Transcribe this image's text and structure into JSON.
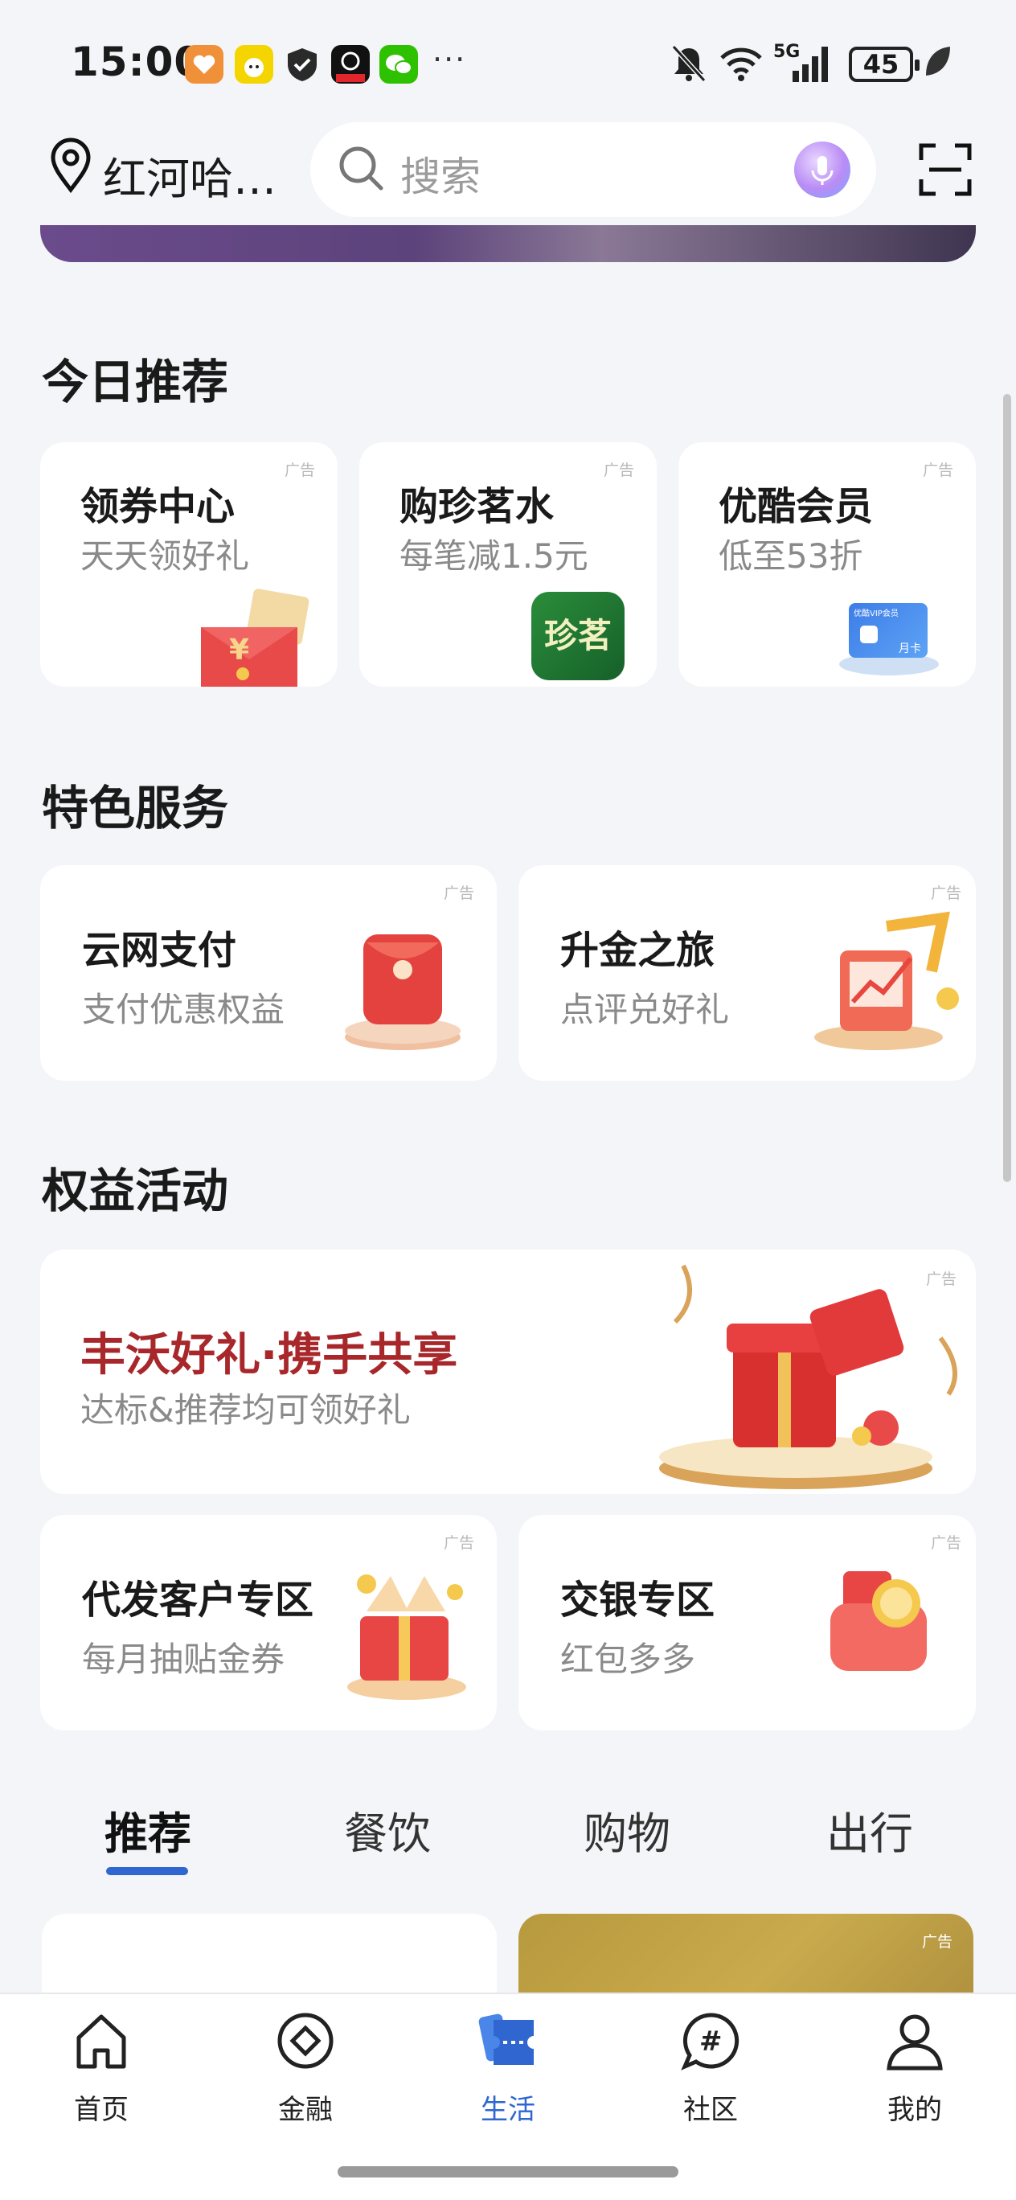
{
  "status_bar": {
    "time": "15:00",
    "network": "5G",
    "battery": "45"
  },
  "header": {
    "location": "红河哈…",
    "search_placeholder": "搜索"
  },
  "today_section": {
    "title": "今日推荐",
    "cards": [
      {
        "title": "领券中心",
        "subtitle": "天天领好礼",
        "ad": "广告"
      },
      {
        "title": "购珍茗水",
        "subtitle": "每笔减1.5元",
        "ad": "广告",
        "logo_text": "珍茗"
      },
      {
        "title": "优酷会员",
        "subtitle": "低至53折",
        "ad": "广告",
        "card_top": "优酷VIP会员",
        "card_bottom": "月卡"
      }
    ]
  },
  "featured_section": {
    "title": "特色服务",
    "cards": [
      {
        "title": "云网支付",
        "subtitle": "支付优惠权益",
        "ad": "广告"
      },
      {
        "title": "升金之旅",
        "subtitle": "点评兑好礼",
        "ad": "广告"
      }
    ]
  },
  "benefits_section": {
    "title": "权益活动",
    "banner": {
      "title": "丰沃好礼·携手共享",
      "subtitle": "达标&推荐均可领好礼",
      "ad": "广告"
    },
    "cards": [
      {
        "title": "代发客户专区",
        "subtitle": "每月抽贴金券",
        "ad": "广告"
      },
      {
        "title": "交银专区",
        "subtitle": "红包多多",
        "ad": "广告"
      }
    ]
  },
  "category_tabs": [
    "推荐",
    "餐饮",
    "购物",
    "出行"
  ],
  "feed": {
    "ad": "广告"
  },
  "bottom_nav": [
    {
      "label": "首页",
      "icon": "home-icon"
    },
    {
      "label": "金融",
      "icon": "finance-icon"
    },
    {
      "label": "生活",
      "icon": "life-ticket-icon"
    },
    {
      "label": "社区",
      "icon": "community-hash-icon"
    },
    {
      "label": "我的",
      "icon": "profile-icon"
    }
  ],
  "colors": {
    "accent": "#2f66d0",
    "banner_title": "#a8272b",
    "background": "#f4f5f8"
  }
}
